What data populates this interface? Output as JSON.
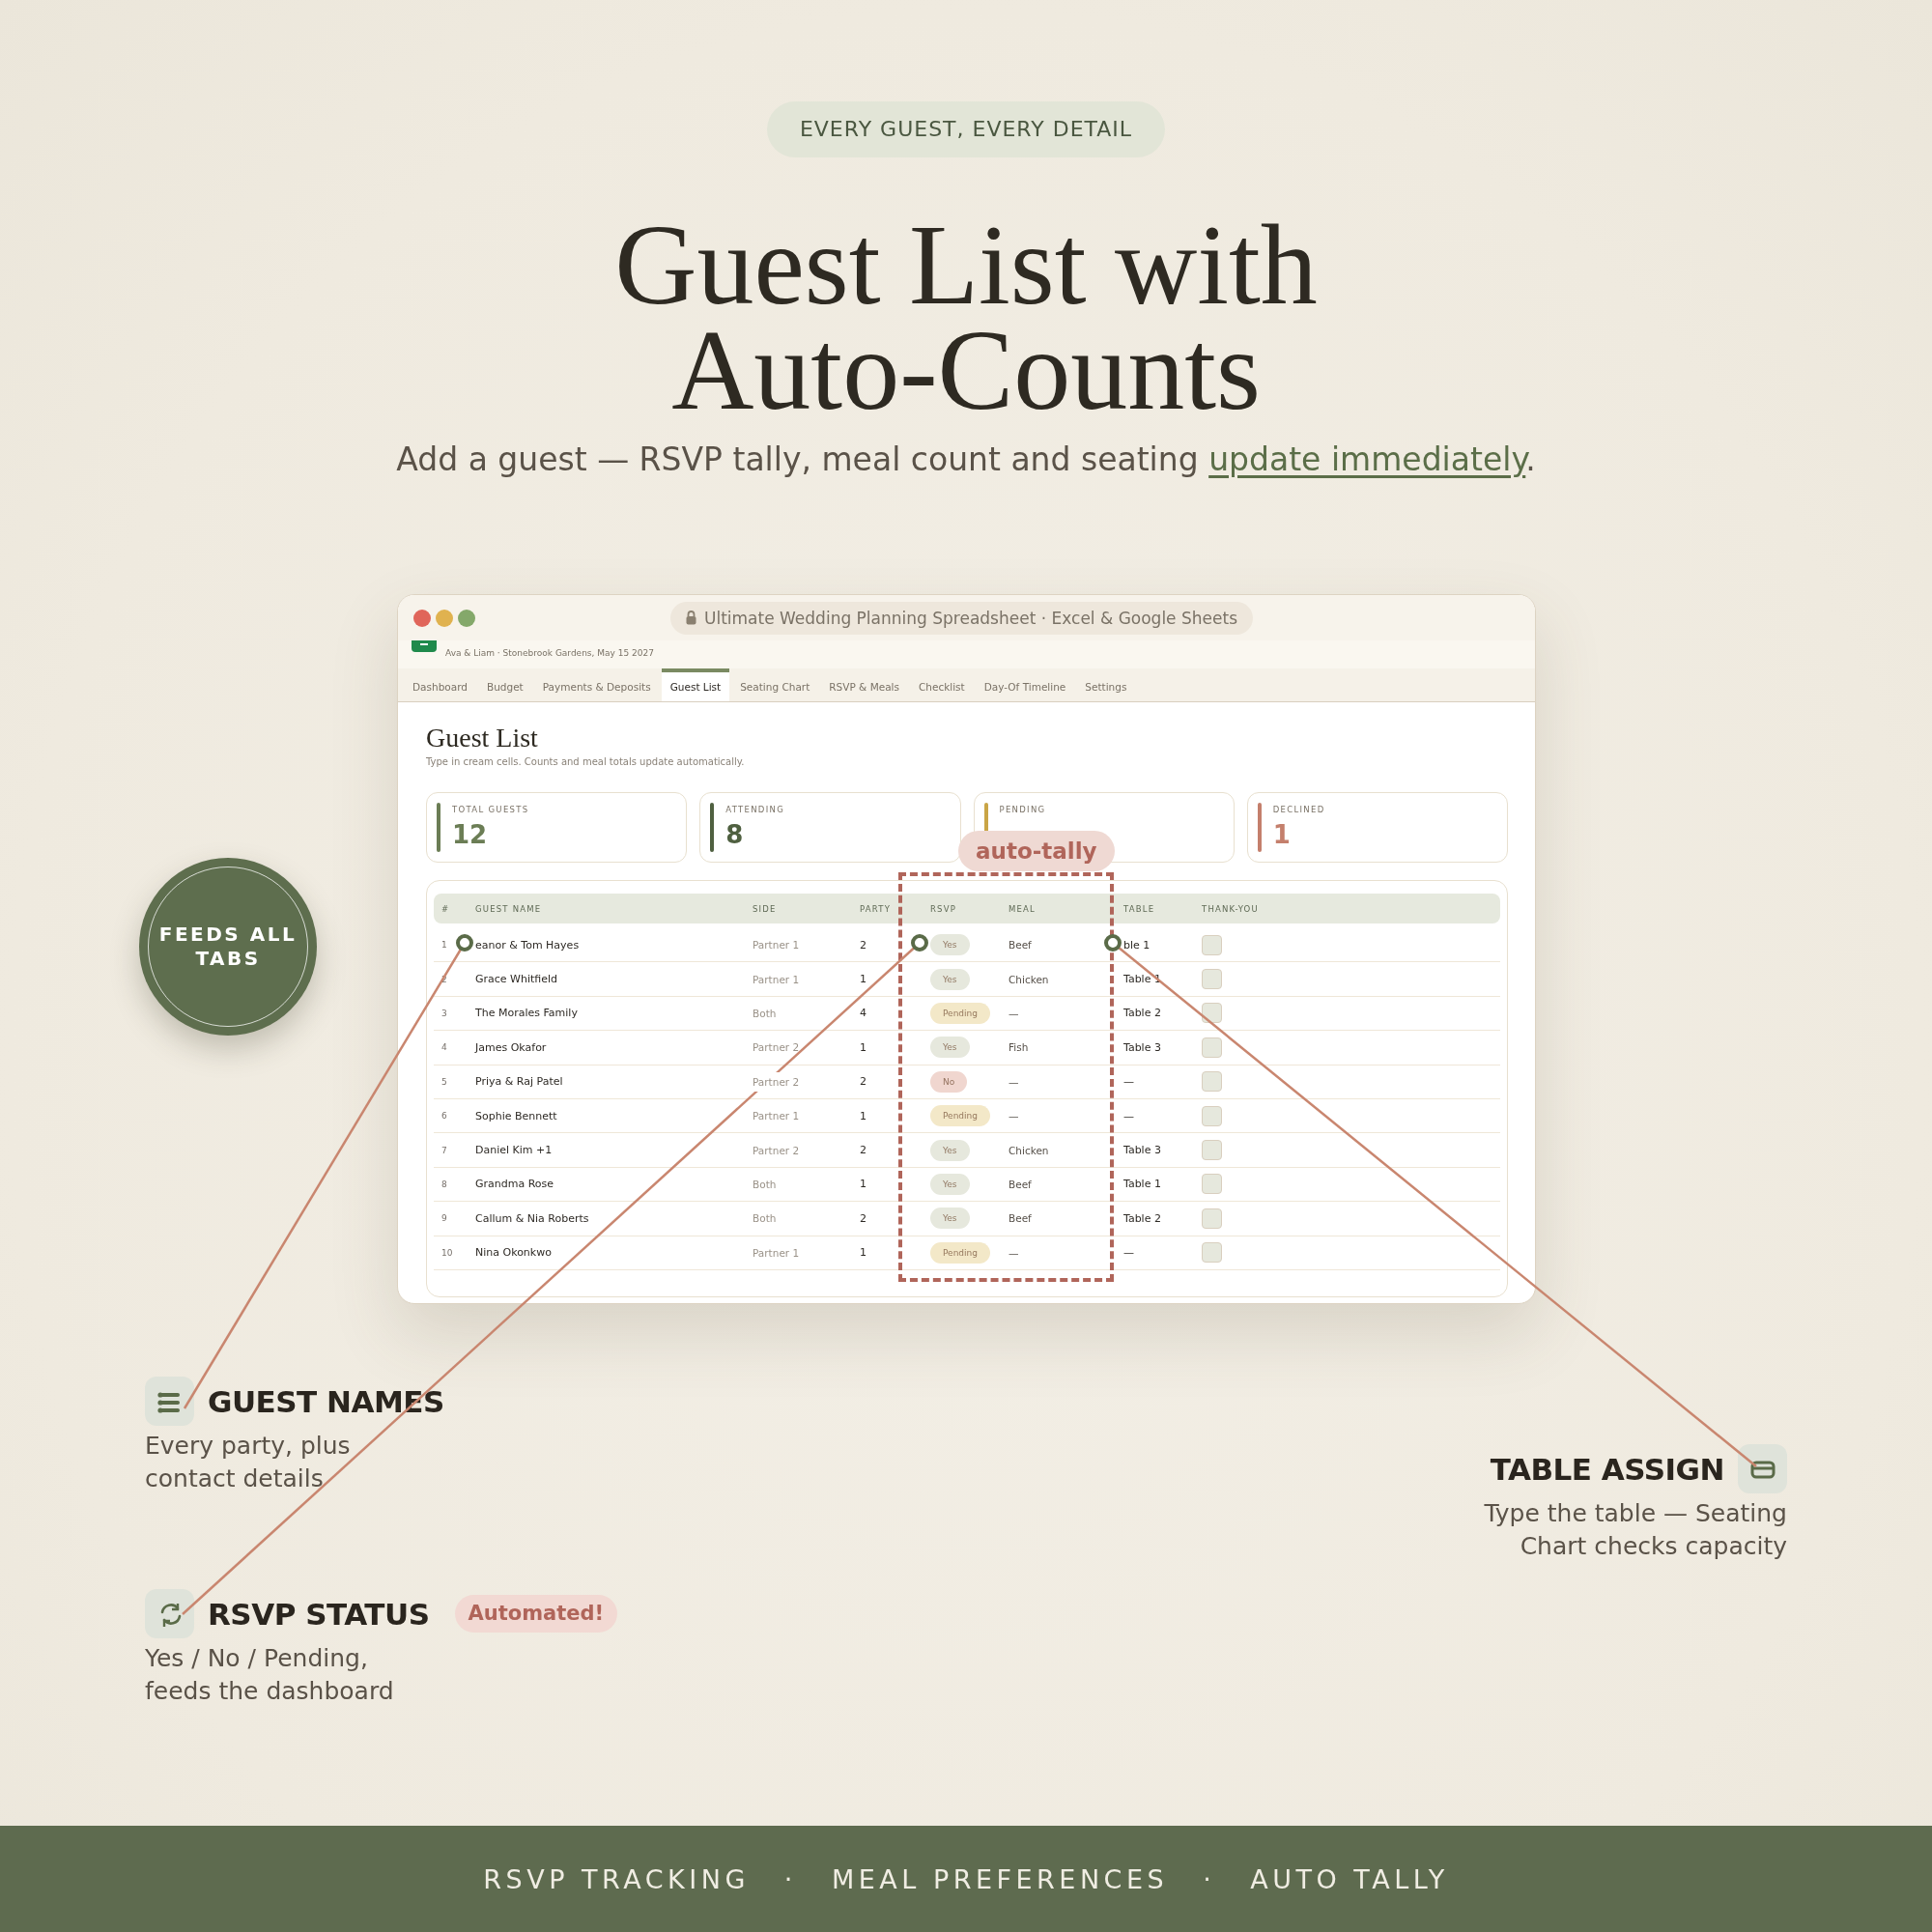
{
  "header": {
    "eyebrow": "EVERY GUEST, EVERY DETAIL",
    "title_lines": [
      "Guest List with",
      "Auto-Counts"
    ],
    "subtitle": "Add a guest — RSVP tally, meal count and seating ",
    "subtitle_link": "update immediately",
    "subtitle_end": "."
  },
  "window": {
    "address": "Ultimate Wedding Planning Spreadsheet · Excel & Google Sheets",
    "workbook_subtitle": "Ava & Liam · Stonebrook Gardens, May 15 2027",
    "tabs": [
      {
        "label": "Dashboard",
        "selected": false
      },
      {
        "label": "Budget",
        "selected": false
      },
      {
        "label": "Payments & Deposits",
        "selected": false
      },
      {
        "label": "Guest List",
        "selected": true
      },
      {
        "label": "Seating Chart",
        "selected": false
      },
      {
        "label": "RSVP & Meals",
        "selected": false
      },
      {
        "label": "Checklist",
        "selected": false
      },
      {
        "label": "Day-Of Timeline",
        "selected": false
      },
      {
        "label": "Settings",
        "selected": false
      }
    ],
    "sheet": {
      "title": "Guest List",
      "hint": "Type in cream cells. Counts and meal totals update automatically.",
      "stats": [
        {
          "label": "TOTAL GUESTS",
          "value": "12",
          "color": "#6b7d55"
        },
        {
          "label": "ATTENDING",
          "value": "8",
          "color": "#4f6040"
        },
        {
          "label": "PENDING",
          "color": "#c9a546"
        },
        {
          "label": "DECLINED",
          "value": "1",
          "color": "#c47f6c"
        }
      ],
      "overlay_badge": "auto-tally",
      "table": {
        "columns": [
          "#",
          "GUEST NAME",
          "SIDE",
          "PARTY",
          "RSVP",
          "MEAL",
          "TABLE",
          "THANK-YOU"
        ],
        "rows": [
          {
            "number": "1",
            "name": "eanor & Tom Hayes",
            "side": "Partner 1",
            "party": "2",
            "rsvp": {
              "label": "Yes",
              "color": "#e6e8dd"
            },
            "meal": "Beef",
            "table": "ble 1",
            "thanked": false
          },
          {
            "number": "2",
            "name": "Grace Whitfield",
            "side": "Partner 1",
            "party": "1",
            "rsvp": {
              "label": "Yes",
              "color": "#e6e8dd"
            },
            "meal": "Chicken",
            "table": "Table 1",
            "thanked": false
          },
          {
            "number": "3",
            "name": "The Morales Family",
            "side": "Both",
            "party": "4",
            "rsvp": {
              "label": "Pending",
              "color": "#f3e8c8"
            },
            "meal": "—",
            "table": "Table 2",
            "thanked": false
          },
          {
            "number": "4",
            "name": "James Okafor",
            "side": "Partner 2",
            "party": "1",
            "rsvp": {
              "label": "Yes",
              "color": "#e6e8dd"
            },
            "meal": "Fish",
            "table": "Table 3",
            "thanked": false
          },
          {
            "number": "5",
            "name": "Priya & Raj Patel",
            "side": "Partner 2",
            "party": "2",
            "rsvp": {
              "label": "No",
              "color": "#f0d6cf"
            },
            "meal": "—",
            "table": "—",
            "thanked": false
          },
          {
            "number": "6",
            "name": "Sophie Bennett",
            "side": "Partner 1",
            "party": "1",
            "rsvp": {
              "label": "Pending",
              "color": "#f3e8c8"
            },
            "meal": "—",
            "table": "—",
            "thanked": false
          },
          {
            "number": "7",
            "name": "Daniel Kim +1",
            "side": "Partner 2",
            "party": "2",
            "rsvp": {
              "label": "Yes",
              "color": "#e6e8dd"
            },
            "meal": "Chicken",
            "table": "Table 3",
            "thanked": false
          },
          {
            "number": "8",
            "name": "Grandma Rose",
            "side": "Both",
            "party": "1",
            "rsvp": {
              "label": "Yes",
              "color": "#e6e8dd"
            },
            "meal": "Beef",
            "table": "Table 1",
            "thanked": false
          },
          {
            "number": "9",
            "name": "Callum & Nia Roberts",
            "side": "Both",
            "party": "2",
            "rsvp": {
              "label": "Yes",
              "color": "#e6e8dd"
            },
            "meal": "Beef",
            "table": "Table 2",
            "thanked": false
          },
          {
            "number": "10",
            "name": "Nina Okonkwo",
            "side": "Partner 1",
            "party": "1",
            "rsvp": {
              "label": "Pending",
              "color": "#f3e8c8"
            },
            "meal": "—",
            "table": "—",
            "thanked": false
          }
        ]
      }
    }
  },
  "feeds_badge": "FEEDS ALL\nTABS",
  "callouts": [
    {
      "title": "GUEST NAMES",
      "text": "Every party, plus\ncontact details"
    },
    {
      "title": "RSVP STATUS",
      "badge": "Automated!",
      "text": "Yes / No / Pending,\nfeeds the dashboard"
    },
    {
      "title": "TABLE ASSIGN",
      "text": "Type the table — Seating\nChart checks capacity"
    }
  ],
  "footer": {
    "items": [
      "RSVP TRACKING",
      "MEAL PREFERENCES",
      "AUTO TALLY"
    ],
    "separators": [
      "·",
      "·"
    ]
  }
}
